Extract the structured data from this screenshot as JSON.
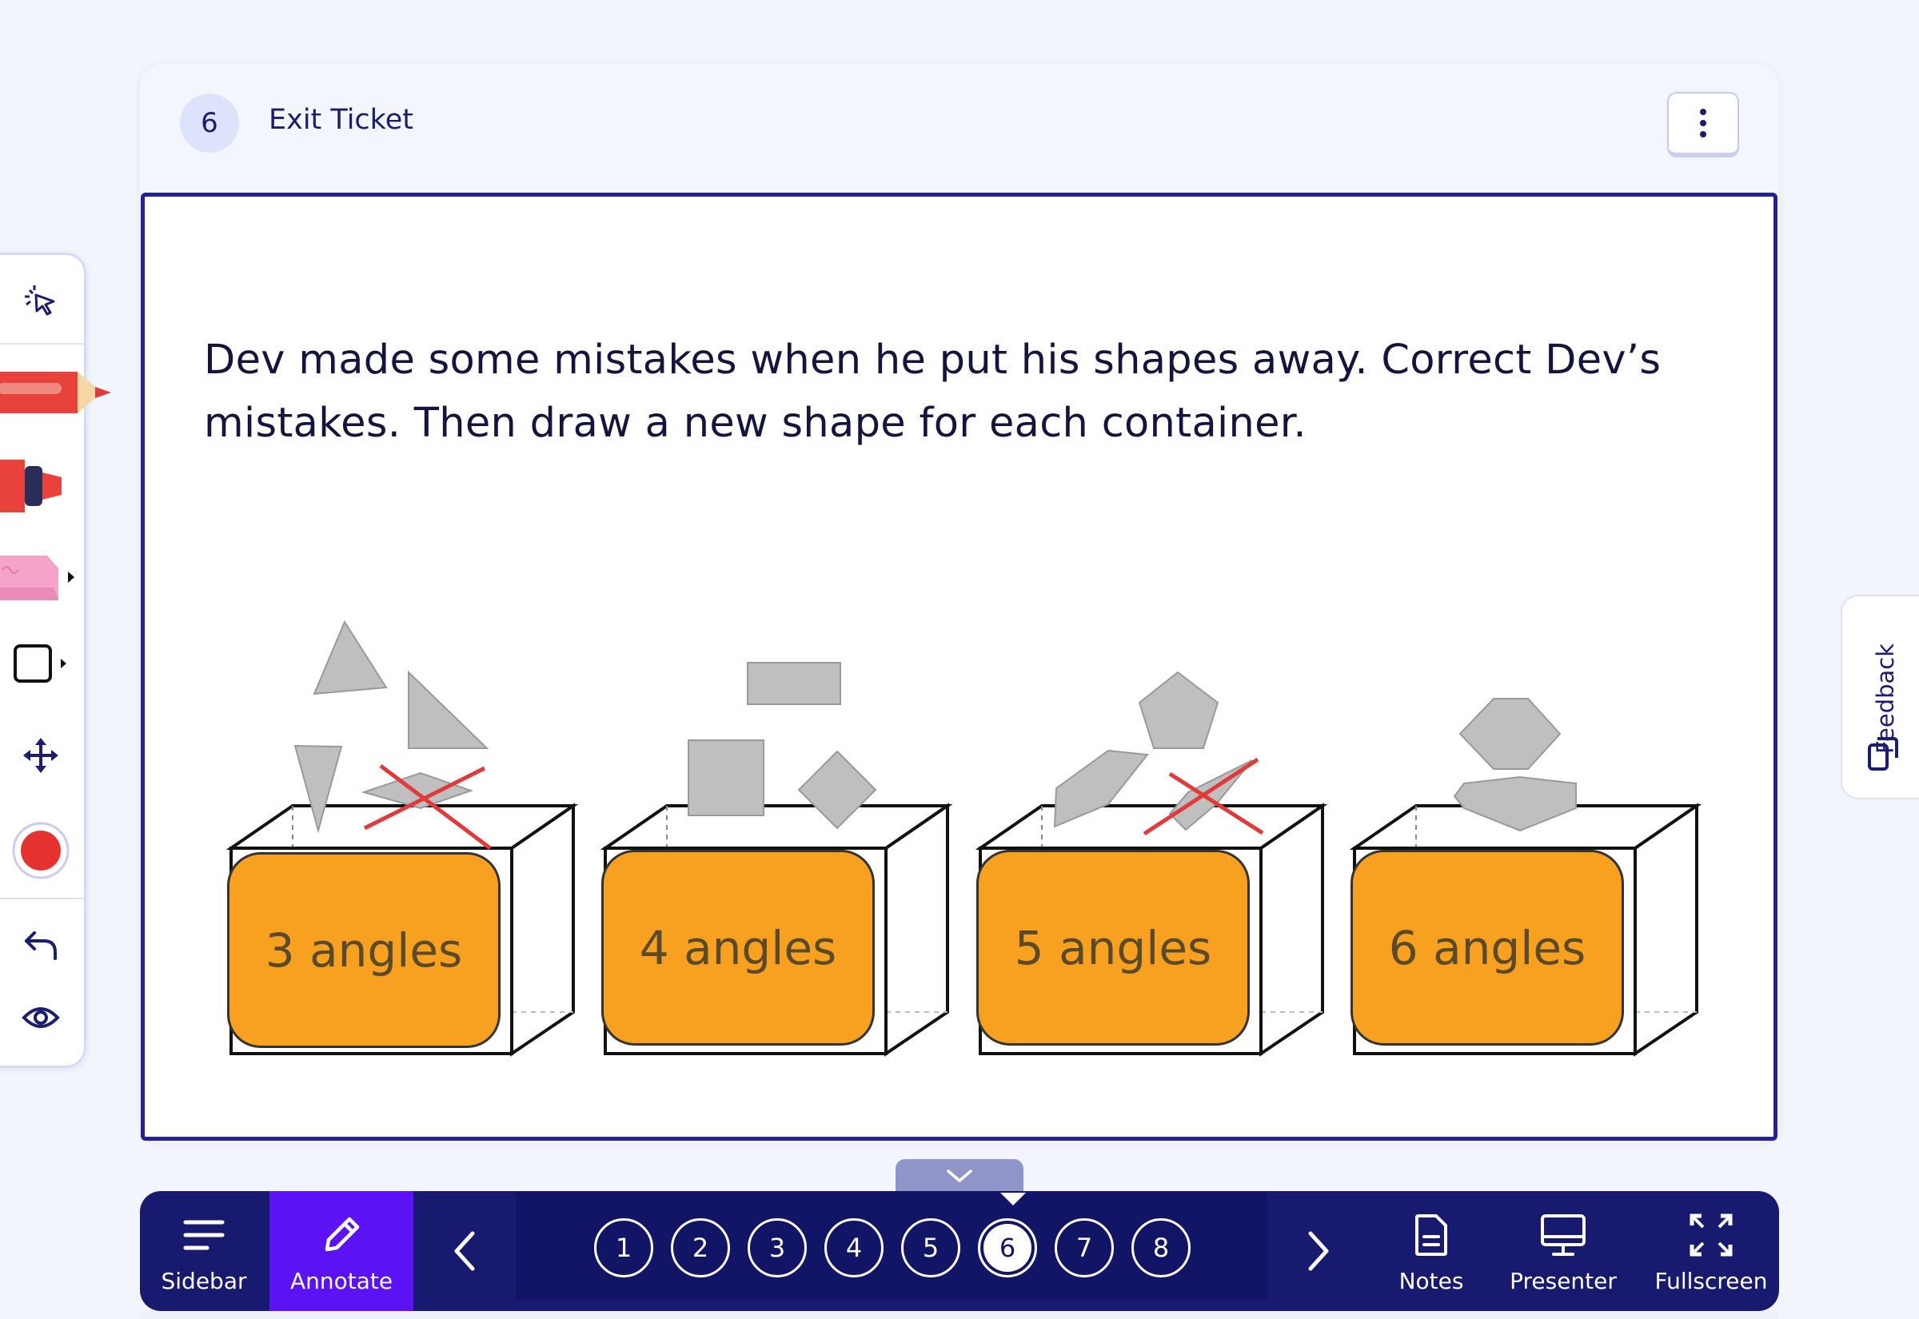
{
  "slide": {
    "number": "6",
    "title": "Exit Ticket",
    "question": "Dev made some mistakes when he put his shapes away. Correct Dev’s mistakes. Then draw a new shape for each container.",
    "containers": [
      {
        "label": "3 angles"
      },
      {
        "label": "4 angles"
      },
      {
        "label": "5 angles"
      },
      {
        "label": "6 angles"
      }
    ]
  },
  "toolbar": {
    "tools": [
      "laser-pointer-icon",
      "pencil-icon",
      "marker-icon",
      "eraser-icon",
      "rectangle-icon",
      "move-icon",
      "color-swatch",
      "undo-icon",
      "eye-icon"
    ],
    "active_color": "#e6322e"
  },
  "feedback": {
    "label": "Feedback"
  },
  "bottombar": {
    "sidebar_label": "Sidebar",
    "annotate_label": "Annotate",
    "notes_label": "Notes",
    "presenter_label": "Presenter",
    "fullscreen_label": "Fullscreen",
    "pages": [
      "1",
      "2",
      "3",
      "4",
      "5",
      "6",
      "7",
      "8"
    ],
    "current_page": "6"
  },
  "colors": {
    "navy": "#181a70",
    "accent": "#5b12f5",
    "orange": "#f8a020",
    "shape_gray": "#bfbfbf"
  }
}
